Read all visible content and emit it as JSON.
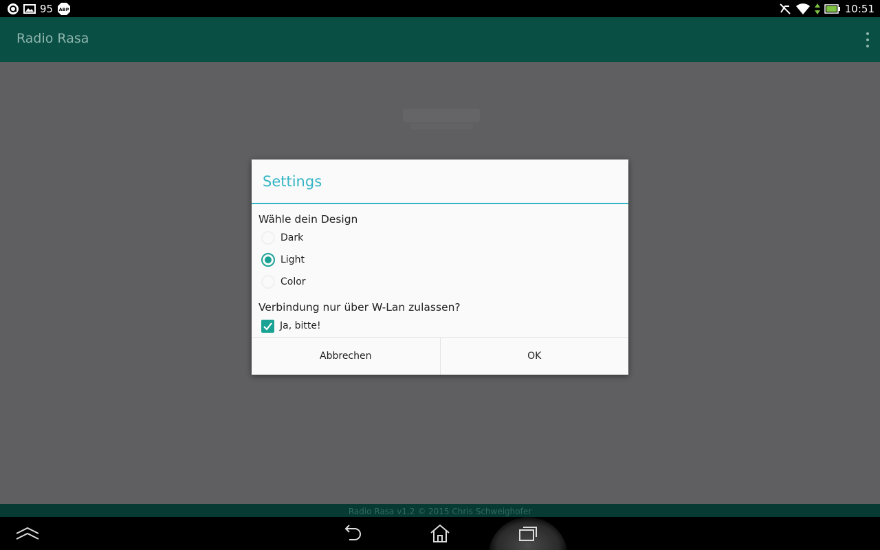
{
  "status_bar": {
    "notification_count": "95",
    "time": "10:51",
    "icons": [
      "circle-a-icon",
      "image-icon",
      "adblock-icon",
      "mute-icon",
      "wifi-icon",
      "battery-icon"
    ]
  },
  "action_bar": {
    "title": "Radio Rasa",
    "overflow_icon": "overflow-menu-icon"
  },
  "dialog": {
    "title": "Settings",
    "design_label": "Wähle dein Design",
    "design_options": [
      "Dark",
      "Light",
      "Color"
    ],
    "selected_design": "Light",
    "wifi_label": "Verbindung nur über W-Lan zulassen?",
    "wifi_checkbox_label": "Ja, bitte!",
    "wifi_checked": true,
    "cancel_label": "Abbrechen",
    "ok_label": "OK"
  },
  "footer": {
    "text": "Radio Rasa v1.2 © 2015 Chris Schweighofer"
  },
  "nav_bar": {
    "icons": [
      "chevron-up-icon",
      "back-icon",
      "home-icon",
      "recent-apps-icon"
    ]
  },
  "colors": {
    "accent": "#33b5c5",
    "control": "#1aa394",
    "action_bar": "#0a4f44",
    "scrim": "#5f5e60"
  }
}
